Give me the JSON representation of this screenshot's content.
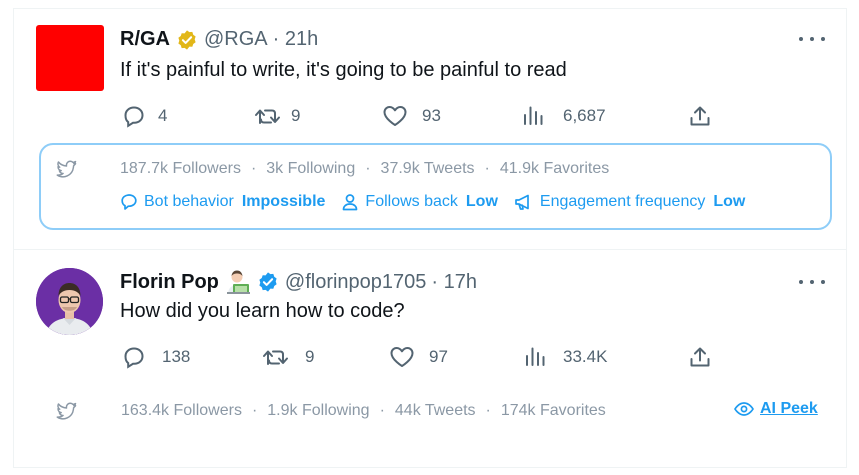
{
  "colors": {
    "accent": "#1d9bf0",
    "muted": "#536471",
    "verified_gold": "#e2b719",
    "verified_blue": "#1d9bf0",
    "rga_red": "#ff0000",
    "stats_border": "#8ecdf8"
  },
  "tweets": [
    {
      "name": "R/GA",
      "badge": "gold-verified-badge",
      "handle": "@RGA",
      "time": "· 21h",
      "text": "If it's painful to write, it's going to be painful to read",
      "actions": {
        "replies": "4",
        "retweets": "9",
        "likes": "93",
        "views": "6,687"
      },
      "stats": {
        "followers": "187.7k Followers",
        "following": "3k Following",
        "tweets": "37.9k Tweets",
        "favorites": "41.9k Favorites"
      },
      "info": [
        {
          "icon": "chat-bubble-icon",
          "label": "Bot behavior",
          "value": "Impossible"
        },
        {
          "icon": "person-icon",
          "label": "Follows back",
          "value": "Low"
        },
        {
          "icon": "megaphone-icon",
          "label": "Engagement frequency",
          "value": "Low"
        }
      ]
    },
    {
      "name": "Florin Pop",
      "badge": "blue-verified-badge",
      "emoji": "technologist-emoji",
      "handle": "@florinpop1705",
      "time": "· 17h",
      "text": "How did you learn how to code?",
      "actions": {
        "replies": "138",
        "retweets": "9",
        "likes": "97",
        "views": "33.4K"
      },
      "stats": {
        "followers": "163.4k Followers",
        "following": "1.9k Following",
        "tweets": "44k Tweets",
        "favorites": "174k Favorites"
      },
      "ai_peek": "AI Peek"
    }
  ],
  "separator": "·"
}
